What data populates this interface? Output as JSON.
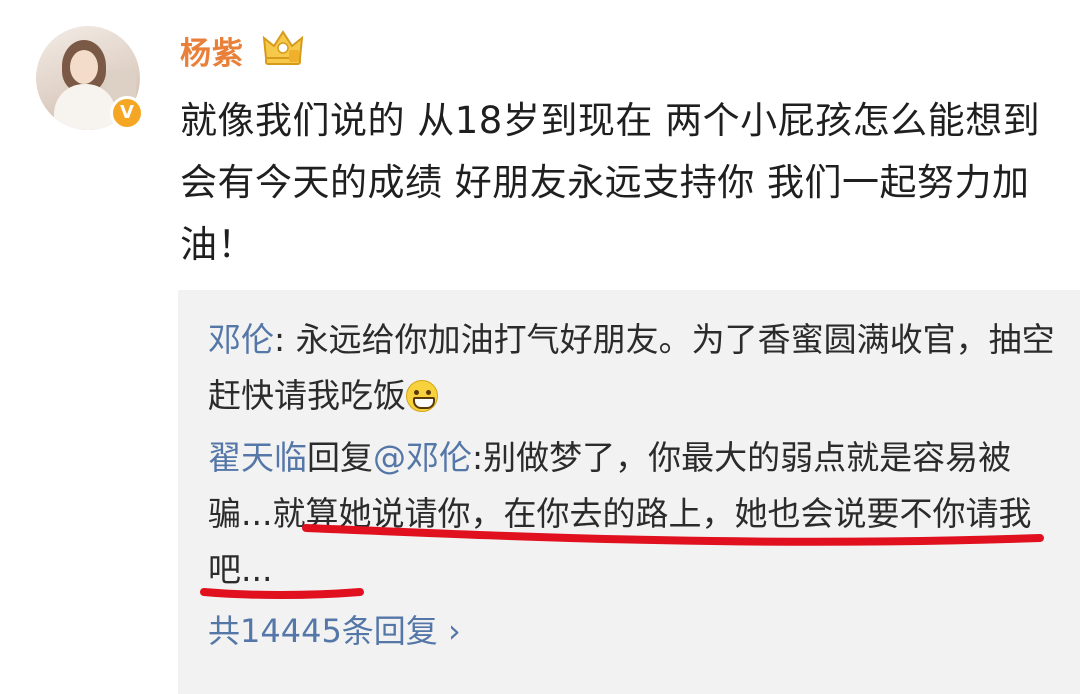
{
  "post": {
    "username": "杨紫",
    "text": "就像我们说的 从18岁到现在 两个小屁孩怎么能想到会有今天的成绩 好朋友永远支持你 我们一起努力加油！",
    "verified_badge": "V",
    "crown_icon": "crown-icon"
  },
  "comments": [
    {
      "author": "邓伦",
      "separator": ": ",
      "text": "永远给你加油打气好朋友。为了香蜜圆满收官，抽空赶快请我吃饭",
      "emoji": "grin-emoji-icon"
    },
    {
      "author": "翟天临",
      "reply_prefix": "回复",
      "mention": "@邓伦",
      "separator": ":",
      "text": "别做梦了，你最大的弱点就是容易被骗...就算她说请你，在你去的路上，她也会说要不你请我吧..."
    }
  ],
  "replies_link": {
    "label": "共14445条回复",
    "chevron": "›"
  },
  "colors": {
    "username": "#e8803a",
    "link": "#5577a8",
    "underline": "#e0101e",
    "comment_bg": "#f2f2f2"
  }
}
